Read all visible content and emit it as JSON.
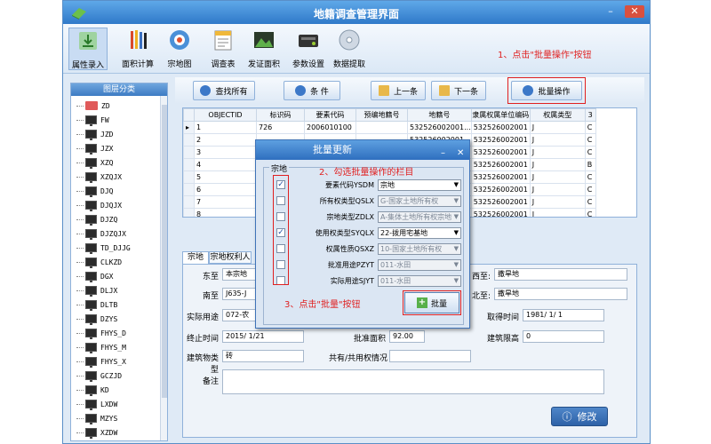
{
  "window": {
    "title": "地籍调查管理界面"
  },
  "toolbar": {
    "items": [
      {
        "label": "属性录入"
      },
      {
        "label": "面积计算"
      },
      {
        "label": "宗地图"
      },
      {
        "label": "调查表"
      },
      {
        "label": "发证面积"
      },
      {
        "label": "参数设置"
      },
      {
        "label": "数据提取"
      }
    ]
  },
  "annotations": {
    "step1": "1、点击\"批量操作\"按钮",
    "step2": "2、勾选批量操作的栏目",
    "step3": "3、点击\"批量\"按钮"
  },
  "sidebar": {
    "title": "图层分类",
    "items": [
      "ZD",
      "FW",
      "JZD",
      "JZX",
      "XZQ",
      "XZQJX",
      "DJQ",
      "DJQJX",
      "DJZQ",
      "DJZQJX",
      "TD_DJJG",
      "CLKZD",
      "DGX",
      "DLJX",
      "DLTB",
      "DZYS",
      "FHYS_D",
      "FHYS_M",
      "FHYS_X",
      "GCZJD",
      "KD",
      "LXDW",
      "MZYS",
      "XZDW"
    ]
  },
  "buttons": {
    "search_all": "查找所有",
    "condition": "条 件",
    "prev": "上一条",
    "next": "下一条",
    "batch_op": "批量操作"
  },
  "grid": {
    "columns": [
      "OBJECTID",
      "标识码",
      "要素代码",
      "预编地籍号",
      "地籍号",
      "隶属权属单位编码",
      "权属类型",
      "3"
    ],
    "rows": [
      [
        "1",
        "726",
        "2006010100",
        "",
        "532526002001...",
        "532526002001",
        "J",
        "C"
      ],
      [
        "2",
        "",
        "",
        "",
        "532526002001...",
        "532526002001",
        "J",
        "C"
      ],
      [
        "3",
        "",
        "",
        "",
        "532526002001...",
        "532526002001",
        "J",
        "C"
      ],
      [
        "4",
        "",
        "",
        "",
        "532526002001...",
        "532526002001",
        "J",
        "B"
      ],
      [
        "5",
        "",
        "",
        "",
        "532526002001...",
        "532526002001",
        "J",
        "C"
      ],
      [
        "6",
        "",
        "",
        "",
        "532526002001...",
        "532526002001",
        "J",
        "C"
      ],
      [
        "7",
        "",
        "",
        "",
        "532526002001...",
        "532526002001",
        "J",
        "C"
      ],
      [
        "8",
        "",
        "",
        "",
        "532526002001...",
        "532526002001",
        "J",
        "C"
      ]
    ]
  },
  "tabs": [
    "宗地",
    "宗地权利人"
  ],
  "form": {
    "east_label": "东至",
    "east_value": "本宗地",
    "south_label": "南至",
    "south_value": "J635-J",
    "west_label": "西至:",
    "west_value": "撒旱地",
    "north_label": "北至:",
    "north_value": "撒旱地",
    "actual_use_label": "实际用途",
    "actual_use_value": "072-农",
    "acquire_time_label": "取得时间",
    "acquire_time_value": "1981/ 1/ 1",
    "end_time_label": "终止时间",
    "end_time_value": "2015/ 1/21",
    "approve_area_label": "批准面积",
    "approve_area_value": "92.00",
    "building_limit_label": "建筑限高",
    "building_limit_value": "0",
    "building_type_label": "建筑物类型",
    "building_type_value": "砖",
    "shared_label": "共有/共用权情况",
    "shared_value": "",
    "remark_label": "备注",
    "modify_label": "修改"
  },
  "dialog": {
    "title": "批量更新",
    "group_label": "宗地",
    "fields": [
      {
        "label": "要素代码YSDM",
        "value": "宗地",
        "checked": true,
        "enabled": true
      },
      {
        "label": "所有权类型QSLX",
        "value": "G-国家土地所有权",
        "checked": false,
        "enabled": false
      },
      {
        "label": "宗地类型ZDLX",
        "value": "A-集体土地所有权宗地",
        "checked": false,
        "enabled": false
      },
      {
        "label": "使用权类型SYQLX",
        "value": "22-拨用宅基地",
        "checked": true,
        "enabled": true
      },
      {
        "label": "权属性质QSXZ",
        "value": "10-国家土地所有权",
        "checked": false,
        "enabled": false
      },
      {
        "label": "批准用途PZYT",
        "value": "011-水田",
        "checked": false,
        "enabled": false
      },
      {
        "label": "实际用途SJYT",
        "value": "011-水田",
        "checked": false,
        "enabled": false
      }
    ],
    "batch_label": "批量"
  },
  "colors": {
    "accent": "#2f79c9",
    "annotation": "#e02020"
  }
}
